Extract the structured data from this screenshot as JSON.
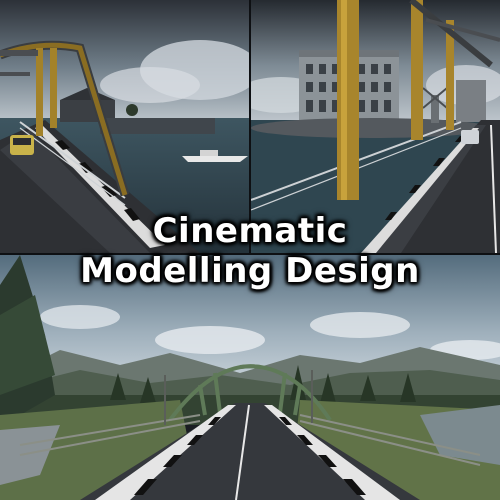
{
  "title": {
    "line1": "Cinematic",
    "line2": "Modelling Design"
  },
  "colors": {
    "bridge_green": "#5f7a58",
    "bridge_yellow": "#b08a2c",
    "road": "#34373c",
    "water": "#3f5a66",
    "sky_top": "#5d7484",
    "sky_bottom": "#dfe5ea"
  }
}
